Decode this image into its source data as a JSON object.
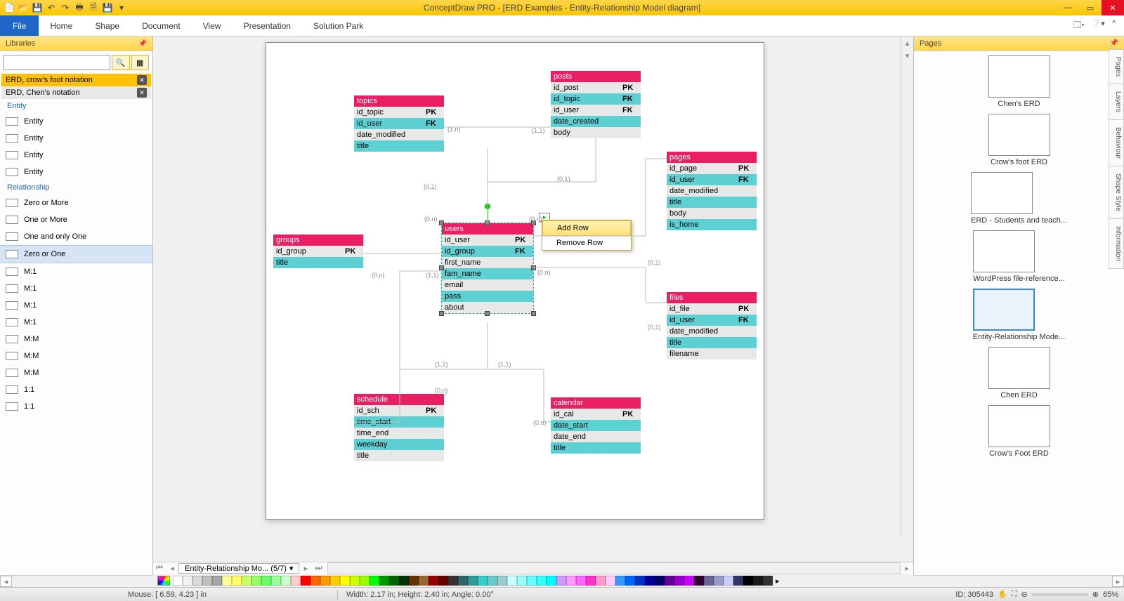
{
  "title": "ConceptDraw PRO - [ERD Examples - Entity-Relationship Model diagram]",
  "ribbon": {
    "file": "File",
    "tabs": [
      "Home",
      "Shape",
      "Document",
      "View",
      "Presentation",
      "Solution Park"
    ]
  },
  "left": {
    "header": "Libraries",
    "pills": [
      {
        "label": "ERD, crow's foot notation",
        "active": true
      },
      {
        "label": "ERD, Chen's notation",
        "active": false
      }
    ],
    "sections": {
      "entity": {
        "header": "Entity",
        "items": [
          "Entity",
          "Entity",
          "Entity",
          "Entity"
        ]
      },
      "relationship": {
        "header": "Relationship",
        "items": [
          "Zero or More",
          "One or More",
          "One and only One",
          "Zero or One",
          "M:1",
          "M:1",
          "M:1",
          "M:1",
          "M:M",
          "M:M",
          "M:M",
          "1:1",
          "1:1"
        ]
      }
    },
    "selected": "Zero or One"
  },
  "popup": {
    "add": "Add Row",
    "remove": "Remove Row"
  },
  "entities": {
    "topics": {
      "title": "topics",
      "rows": [
        [
          "id_topic",
          "PK"
        ],
        [
          "id_user",
          "FK"
        ],
        [
          "date_modified",
          ""
        ],
        [
          "title",
          ""
        ]
      ]
    },
    "posts": {
      "title": "posts",
      "rows": [
        [
          "id_post",
          "PK"
        ],
        [
          "id_topic",
          "FK"
        ],
        [
          "id_user",
          "FK"
        ],
        [
          "date_created",
          ""
        ],
        [
          "body",
          ""
        ]
      ]
    },
    "pages": {
      "title": "pages",
      "rows": [
        [
          "id_page",
          "PK"
        ],
        [
          "id_user",
          "FK"
        ],
        [
          "date_modified",
          ""
        ],
        [
          "title",
          ""
        ],
        [
          "body",
          ""
        ],
        [
          "is_home",
          ""
        ]
      ]
    },
    "groups": {
      "title": "groups",
      "rows": [
        [
          "id_group",
          "PK"
        ],
        [
          "title",
          ""
        ]
      ]
    },
    "users": {
      "title": "users",
      "rows": [
        [
          "id_user",
          "PK"
        ],
        [
          "id_group",
          "FK"
        ],
        [
          "first_name",
          ""
        ],
        [
          "fam_name",
          ""
        ],
        [
          "email",
          ""
        ],
        [
          "pass",
          ""
        ],
        [
          "about",
          ""
        ]
      ]
    },
    "files": {
      "title": "files",
      "rows": [
        [
          "id_file",
          "PK"
        ],
        [
          "id_user",
          "FK"
        ],
        [
          "date_modified",
          ""
        ],
        [
          "title",
          ""
        ],
        [
          "filename",
          ""
        ]
      ]
    },
    "schedule": {
      "title": "schedule",
      "rows": [
        [
          "id_sch",
          "PK"
        ],
        [
          "time_start",
          ""
        ],
        [
          "time_end",
          ""
        ],
        [
          "weekday",
          ""
        ],
        [
          "title",
          ""
        ]
      ]
    },
    "calendar": {
      "title": "calendar",
      "rows": [
        [
          "id_cal",
          "PK"
        ],
        [
          "date_start",
          ""
        ],
        [
          "date_end",
          ""
        ],
        [
          "title",
          ""
        ]
      ]
    }
  },
  "cardinalities": {
    "c1": "(1,n)",
    "c2": "(1,1)",
    "c3": "(0,1)",
    "c4": "(0,1)",
    "c5": "(0,n)",
    "c6": "(1,1)",
    "c7": "(0,n)",
    "c8": "(0,n)",
    "c9": "(0,1)",
    "c10": "(0,1)",
    "c11": "(1,1)",
    "c12": "(1,1)",
    "c13": "(0,n)",
    "c14": "(0,n)",
    "c15": "(0,n)"
  },
  "pagetab": "Entity-Relationship Mo... (5/7)",
  "pagesPanel": {
    "header": "Pages",
    "thumbs": [
      {
        "label": "Chen's ERD"
      },
      {
        "label": "Crow's foot ERD"
      },
      {
        "label": "ERD - Students and teach..."
      },
      {
        "label": "WordPress file-reference..."
      },
      {
        "label": "Entity-Relationship Mode...",
        "selected": true
      },
      {
        "label": "Chen ERD"
      },
      {
        "label": "Crow's Foot ERD"
      }
    ],
    "sideTabs": [
      "Pages",
      "Layers",
      "Behaviour",
      "Shape Style",
      "Information"
    ]
  },
  "status": {
    "mouse": "Mouse: [ 6.59, 4.23 ] in",
    "dims": "Width: 2.17 in;  Height: 2.40 in;  Angle: 0.00°",
    "id": "ID: 305443",
    "zoom": "65%"
  },
  "palette": [
    "#ffffff",
    "#f2f2f2",
    "#d9d9d9",
    "#bfbfbf",
    "#a6a6a6",
    "#ffff99",
    "#ffff66",
    "#ccff66",
    "#99ff66",
    "#66ff66",
    "#99ff99",
    "#ccffcc",
    "#ffcccc",
    "#ff0000",
    "#ff6600",
    "#ff9900",
    "#ffcc00",
    "#ffff00",
    "#ccff00",
    "#99ff00",
    "#00ff00",
    "#009900",
    "#006600",
    "#003300",
    "#663300",
    "#996633",
    "#990000",
    "#660000",
    "#333333",
    "#336666",
    "#339999",
    "#33cccc",
    "#66cccc",
    "#99cccc",
    "#ccffff",
    "#99ffff",
    "#66ffff",
    "#33ffff",
    "#00ffff",
    "#cc99ff",
    "#ff99ff",
    "#ff66ff",
    "#ff33cc",
    "#ff99cc",
    "#ffccff",
    "#3399ff",
    "#0066ff",
    "#0033cc",
    "#000099",
    "#000066",
    "#660099",
    "#9900cc",
    "#cc00ff",
    "#330033",
    "#666699",
    "#9999cc",
    "#ccccff",
    "#333366",
    "#000000",
    "#1a1a1a",
    "#333333"
  ]
}
